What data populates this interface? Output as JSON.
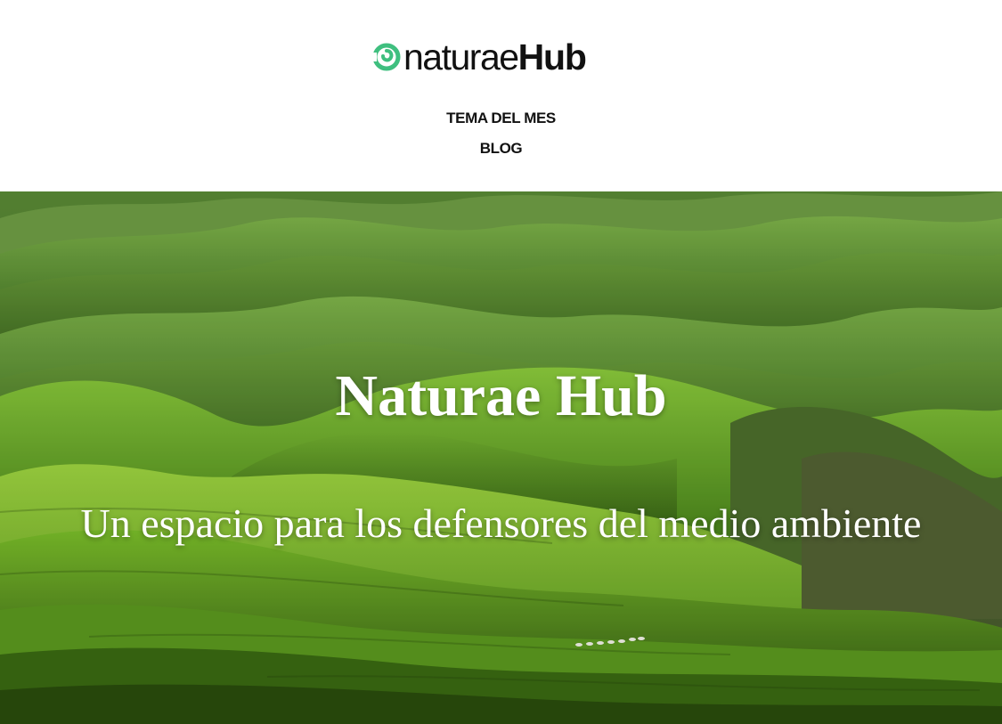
{
  "header": {
    "logo": {
      "light": "naturae",
      "bold": "Hub",
      "icon": "spiral-leaf-icon",
      "accent_color": "#3fbf7f"
    },
    "nav": [
      {
        "label": "TEMA DEL MES"
      },
      {
        "label": "BLOG"
      }
    ]
  },
  "hero": {
    "title": "Naturae Hub",
    "subtitle": "Un espacio para los defensores del medio ambiente",
    "background": "green-rolling-hills-photo"
  }
}
